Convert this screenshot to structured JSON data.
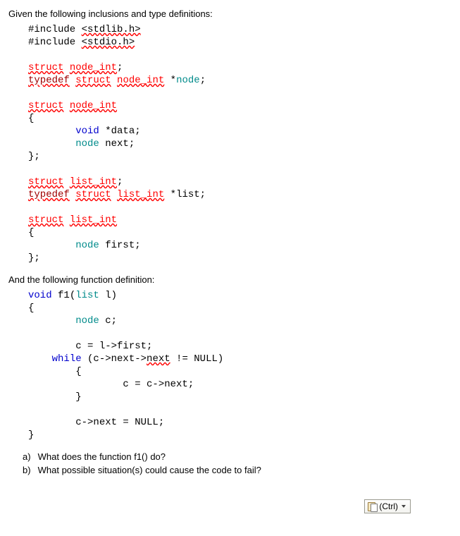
{
  "intro1": "Given the following inclusions and type definitions:",
  "code1_lines": [
    [
      {
        "t": "#include ",
        "c": ""
      },
      {
        "t": "<stdlib.h>",
        "c": "wavy"
      }
    ],
    [
      {
        "t": "#include ",
        "c": ""
      },
      {
        "t": "<stdio.h>",
        "c": "wavy"
      }
    ],
    [
      {
        "t": "",
        "c": ""
      }
    ],
    [
      {
        "t": "struct",
        "c": "err"
      },
      {
        "t": " ",
        "c": ""
      },
      {
        "t": "node_int",
        "c": "err"
      },
      {
        "t": ";",
        "c": ""
      }
    ],
    [
      {
        "t": "typedef",
        "c": "errdark"
      },
      {
        "t": " ",
        "c": ""
      },
      {
        "t": "struct",
        "c": "err"
      },
      {
        "t": " ",
        "c": ""
      },
      {
        "t": "node_int",
        "c": "err"
      },
      {
        "t": " *",
        "c": ""
      },
      {
        "t": "node",
        "c": "typ"
      },
      {
        "t": ";",
        "c": ""
      }
    ],
    [
      {
        "t": "",
        "c": ""
      }
    ],
    [
      {
        "t": "struct",
        "c": "err"
      },
      {
        "t": " ",
        "c": ""
      },
      {
        "t": "node_int",
        "c": "err"
      }
    ],
    [
      {
        "t": "{",
        "c": ""
      }
    ],
    [
      {
        "t": "        ",
        "c": ""
      },
      {
        "t": "void",
        "c": "kw"
      },
      {
        "t": " *data;",
        "c": ""
      }
    ],
    [
      {
        "t": "        ",
        "c": ""
      },
      {
        "t": "node",
        "c": "typ"
      },
      {
        "t": " next;",
        "c": ""
      }
    ],
    [
      {
        "t": "};",
        "c": ""
      }
    ],
    [
      {
        "t": "",
        "c": ""
      }
    ],
    [
      {
        "t": "struct",
        "c": "err"
      },
      {
        "t": " ",
        "c": ""
      },
      {
        "t": "list_int",
        "c": "err"
      },
      {
        "t": ";",
        "c": ""
      }
    ],
    [
      {
        "t": "typedef",
        "c": "errdark"
      },
      {
        "t": " ",
        "c": ""
      },
      {
        "t": "struct",
        "c": "err"
      },
      {
        "t": " ",
        "c": ""
      },
      {
        "t": "list_int",
        "c": "err"
      },
      {
        "t": " *list;",
        "c": ""
      }
    ],
    [
      {
        "t": "",
        "c": ""
      }
    ],
    [
      {
        "t": "struct",
        "c": "err"
      },
      {
        "t": " ",
        "c": ""
      },
      {
        "t": "list_int",
        "c": "err"
      }
    ],
    [
      {
        "t": "{",
        "c": ""
      }
    ],
    [
      {
        "t": "        ",
        "c": ""
      },
      {
        "t": "node",
        "c": "typ"
      },
      {
        "t": " first;",
        "c": ""
      }
    ],
    [
      {
        "t": "};",
        "c": ""
      }
    ]
  ],
  "intro2": "And the following function definition:",
  "code2_lines": [
    [
      {
        "t": "void",
        "c": "kw"
      },
      {
        "t": " f1(",
        "c": ""
      },
      {
        "t": "list",
        "c": "typ"
      },
      {
        "t": " l)",
        "c": ""
      }
    ],
    [
      {
        "t": "{",
        "c": ""
      }
    ],
    [
      {
        "t": "        ",
        "c": ""
      },
      {
        "t": "node",
        "c": "typ"
      },
      {
        "t": " c;",
        "c": ""
      }
    ],
    [
      {
        "t": "",
        "c": ""
      }
    ],
    [
      {
        "t": "        c = l->first;",
        "c": ""
      }
    ],
    [
      {
        "t": "    ",
        "c": ""
      },
      {
        "t": "while",
        "c": "kw"
      },
      {
        "t": " (c->next->",
        "c": ""
      },
      {
        "t": "next",
        "c": "wavy"
      },
      {
        "t": " != NULL)",
        "c": ""
      }
    ],
    [
      {
        "t": "        {",
        "c": ""
      }
    ],
    [
      {
        "t": "                c = c->next;",
        "c": ""
      }
    ],
    [
      {
        "t": "        }",
        "c": ""
      }
    ],
    [
      {
        "t": "",
        "c": ""
      }
    ],
    [
      {
        "t": "        c->next = NULL;",
        "c": ""
      }
    ],
    [
      {
        "t": "}",
        "c": ""
      }
    ]
  ],
  "qa": "a)",
  "q1": "What  does the function f1() do?",
  "qb": "b)",
  "q2": "What possible situation(s) could cause the code to fail?",
  "paste_label": "(Ctrl)"
}
